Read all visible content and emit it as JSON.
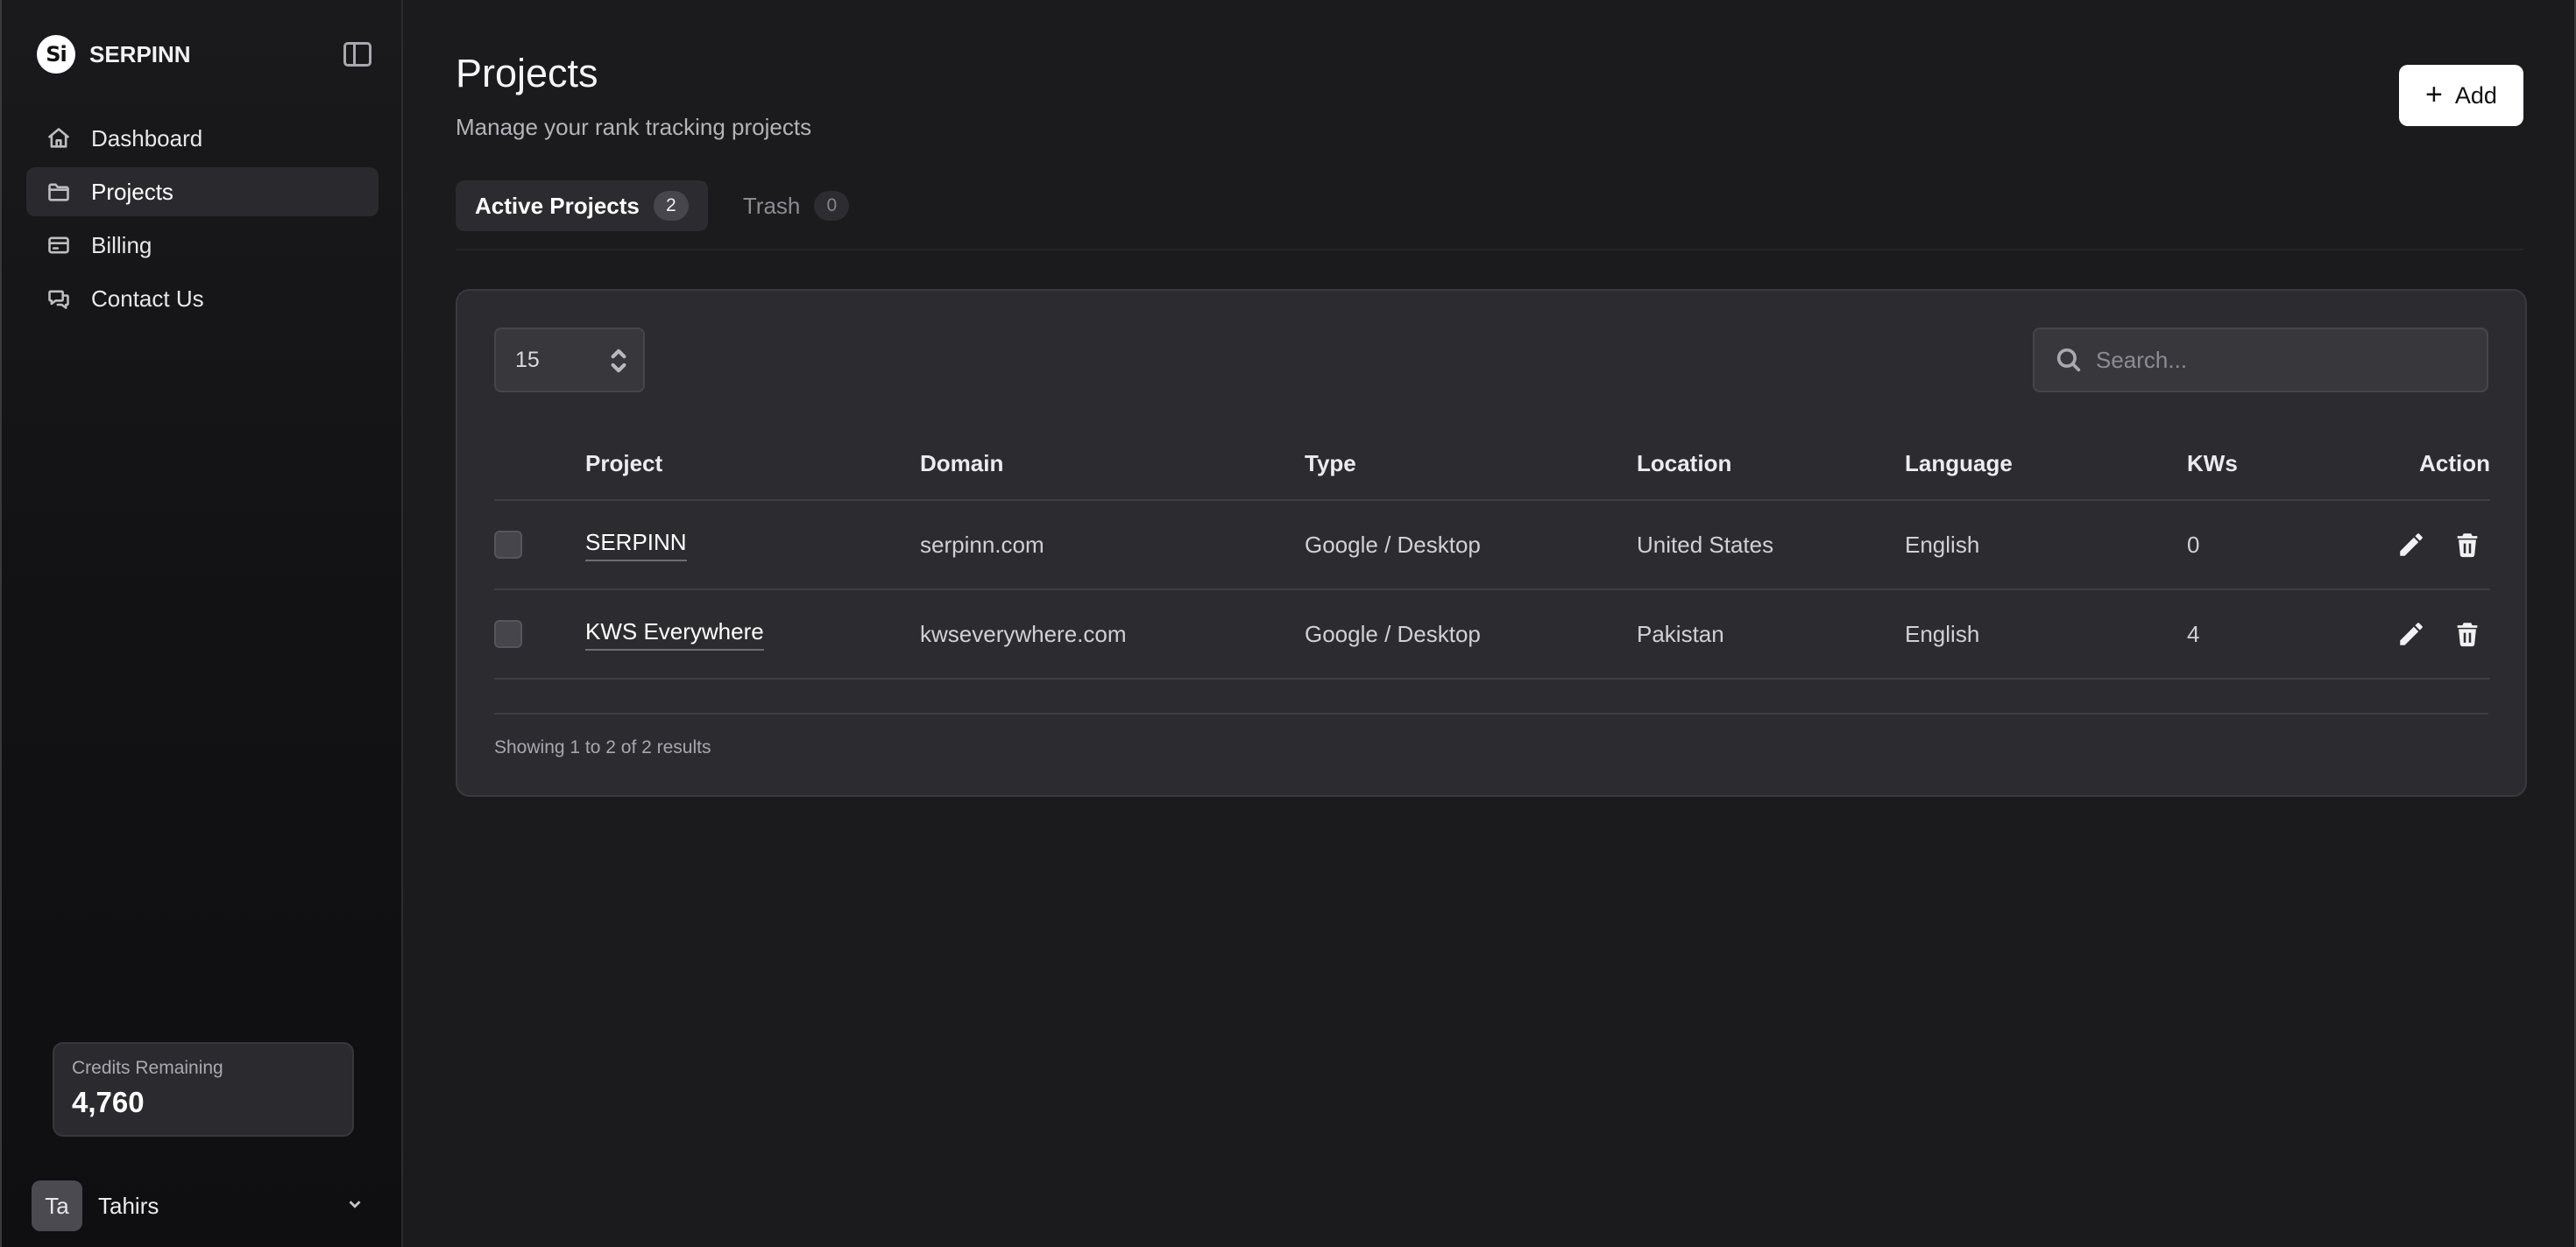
{
  "brand": {
    "logo_text": "Si",
    "name": "SERPINN"
  },
  "sidebar": {
    "items": [
      {
        "label": "Dashboard",
        "icon": "home-icon",
        "active": false
      },
      {
        "label": "Projects",
        "icon": "folder-icon",
        "active": true
      },
      {
        "label": "Billing",
        "icon": "credit-card-icon",
        "active": false
      },
      {
        "label": "Contact Us",
        "icon": "chat-icon",
        "active": false
      }
    ],
    "credits": {
      "label": "Credits Remaining",
      "value": "4,760"
    },
    "user": {
      "initials": "Ta",
      "name": "Tahirs"
    }
  },
  "header": {
    "title": "Projects",
    "subtitle": "Manage your rank tracking projects",
    "add_label": "Add"
  },
  "tabs": [
    {
      "label": "Active Projects",
      "count": "2",
      "active": true
    },
    {
      "label": "Trash",
      "count": "0",
      "active": false
    }
  ],
  "controls": {
    "per_page": "15",
    "search_placeholder": "Search..."
  },
  "table": {
    "columns": {
      "project": "Project",
      "domain": "Domain",
      "type": "Type",
      "location": "Location",
      "language": "Language",
      "kws": "KWs",
      "action": "Action"
    },
    "rows": [
      {
        "project": "SERPINN",
        "domain": "serpinn.com",
        "type": "Google / Desktop",
        "location": "United States",
        "language": "English",
        "kws": "0"
      },
      {
        "project": "KWS Everywhere",
        "domain": "kwseverywhere.com",
        "type": "Google / Desktop",
        "location": "Pakistan",
        "language": "English",
        "kws": "4"
      }
    ]
  },
  "pagination": {
    "summary": "Showing 1 to 2 of 2 results"
  },
  "colors": {
    "background": "#1b1b1d",
    "sidebar": "#121214",
    "card": "#2c2c30",
    "accent_button": "#ffffff"
  }
}
